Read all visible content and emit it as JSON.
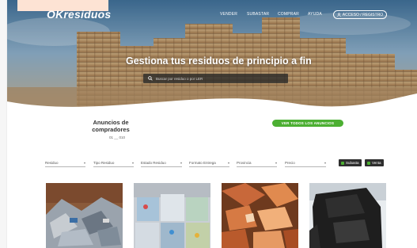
{
  "app": {
    "logo": "OKresiduos"
  },
  "nav": {
    "items": [
      {
        "label": "VENDER"
      },
      {
        "label": "SUBASTAR"
      },
      {
        "label": "COMPRAR"
      },
      {
        "label": "AYUDA"
      }
    ],
    "account_label": "ACCESO / REGISTRO",
    "account_icon": "user-icon"
  },
  "hero": {
    "title": "Gestiona tus residuos de principio a fin",
    "search_placeholder": "Buscar por residuo o por LER",
    "search_icon": "search-icon"
  },
  "buyers": {
    "title": "Anuncios de compradores",
    "count": "01 __ 010",
    "see_all_label": "VER TODOS LOS ANUNCIOS"
  },
  "filters": [
    {
      "label": "Residuo"
    },
    {
      "label": "Tipo Residuo"
    },
    {
      "label": "Estado Residuo"
    },
    {
      "label": "Formato Entrega"
    },
    {
      "label": "Provincia"
    },
    {
      "label": "Precio"
    }
  ],
  "toggles": [
    {
      "label": "Subasta",
      "checked": true
    },
    {
      "label": "Venta",
      "checked": true
    }
  ],
  "listings": [
    {
      "image": "scrap-metal-pile-photo"
    },
    {
      "image": "plastic-bales-photo"
    },
    {
      "image": "copper-scrap-photo"
    },
    {
      "image": "black-baled-material-photo"
    }
  ],
  "colors": {
    "accent_green": "#4caf32",
    "dark": "#2e2e2e",
    "text": "#333333"
  }
}
